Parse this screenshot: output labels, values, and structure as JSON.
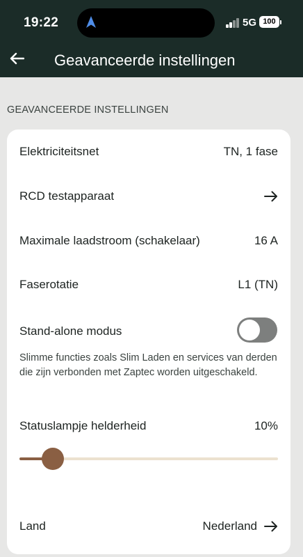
{
  "status_bar": {
    "time": "19:22",
    "network": "5G",
    "battery": "100"
  },
  "header": {
    "title": "Geavanceerde instellingen",
    "back_icon": "arrow-left-icon"
  },
  "section": {
    "label": "GEAVANCEERDE INSTELLINGEN"
  },
  "settings": {
    "grid": {
      "label": "Elektriciteitsnet",
      "value": "TN, 1 fase"
    },
    "rcd": {
      "label": "RCD testapparaat",
      "icon": "arrow-right-icon"
    },
    "max_current": {
      "label": "Maximale laadstroom (schakelaar)",
      "value": "16 A"
    },
    "phase": {
      "label": "Faserotatie",
      "value": "L1 (TN)"
    },
    "standalone": {
      "label": "Stand-alone modus",
      "enabled": false,
      "description": "Slimme functies zoals Slim Laden en services van derden die zijn verbonden met Zaptec worden uitgeschakeld."
    },
    "brightness": {
      "label": "Statuslampje helderheid",
      "value": "10%",
      "level": 0.13
    },
    "country": {
      "label": "Land",
      "value": "Nederland",
      "icon": "arrow-right-icon"
    }
  },
  "colors": {
    "header_bg": "#1b2c28",
    "accent": "#8a5f43",
    "slider_track": "#ece1cf",
    "toggle_off": "#7d7f7e"
  }
}
